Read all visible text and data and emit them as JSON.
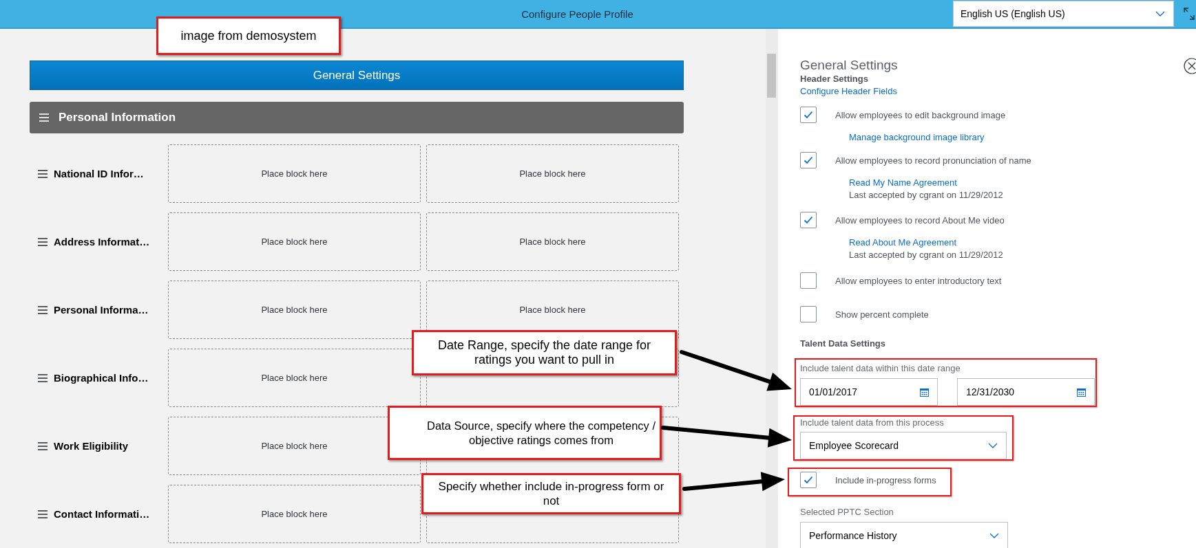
{
  "window": {
    "title": "Configure People Profile"
  },
  "language_select": {
    "value": "English US (English US)"
  },
  "layout": {
    "general_settings_button": "General Settings",
    "section": {
      "title": "Personal Information",
      "rows": [
        {
          "label": "National ID Infor…",
          "slots": [
            {
              "kind": "placeholder",
              "text": "Place block here"
            },
            {
              "kind": "placeholder",
              "text": "Place block here"
            }
          ]
        },
        {
          "label": "Address Informat…",
          "slots": [
            {
              "kind": "placeholder",
              "text": "Place block here"
            },
            {
              "kind": "placeholder",
              "text": "Place block here"
            }
          ]
        },
        {
          "label": "Personal Informa…",
          "slots": [
            {
              "kind": "placeholder",
              "text": "Place block here"
            },
            {
              "kind": "placeholder",
              "text": "Place block here"
            }
          ]
        },
        {
          "label": "Biographical Info…",
          "slots": [
            {
              "kind": "placeholder",
              "text": "Place block here"
            },
            {
              "kind": "blank"
            }
          ]
        },
        {
          "label": "Work Eligibility",
          "slots": [
            {
              "kind": "placeholder",
              "text": "Place block here"
            },
            {
              "kind": "blank"
            }
          ]
        },
        {
          "label": "Contact Informati…",
          "slots": [
            {
              "kind": "placeholder",
              "text": "Place block here"
            },
            {
              "kind": "blank"
            }
          ]
        }
      ]
    }
  },
  "panel": {
    "title": "General Settings",
    "header_settings": {
      "heading": "Header Settings",
      "link": "Configure Header Fields",
      "options": [
        {
          "label": "Allow employees to edit background image",
          "checked": true,
          "link": "Manage background image library"
        },
        {
          "label": "Allow employees to record pronunciation of name",
          "checked": true,
          "link": "Read My Name Agreement",
          "note": "Last accepted by cgrant on 11/29/2012"
        },
        {
          "label": "Allow employees to record About Me video",
          "checked": true,
          "link": "Read About Me Agreement",
          "note": "Last accepted by cgrant on 11/29/2012"
        },
        {
          "label": "Allow employees to enter introductory text",
          "checked": false
        },
        {
          "label": "Show percent complete",
          "checked": false
        }
      ]
    },
    "talent_data_settings": {
      "heading": "Talent Data Settings",
      "date_range": {
        "label": "Include talent data within this date range",
        "from": "01/01/2017",
        "to": "12/31/2030",
        "highlighted": true
      },
      "process": {
        "label": "Include talent data from this process",
        "value": "Employee Scorecard",
        "highlighted": true
      },
      "in_progress": {
        "label": "Include in-progress forms",
        "checked": true,
        "highlighted": true
      },
      "pptc_section": {
        "label": "Selected PPTC Section",
        "value": "Performance History"
      }
    }
  },
  "annotations": [
    {
      "text": "image from demosystem"
    },
    {
      "text": "Date Range, specify the date range for ratings you want to pull in"
    },
    {
      "text": "Data Source, specify where the competency / objective ratings comes from"
    },
    {
      "text": "Specify whether include in-progress form or not"
    }
  ]
}
